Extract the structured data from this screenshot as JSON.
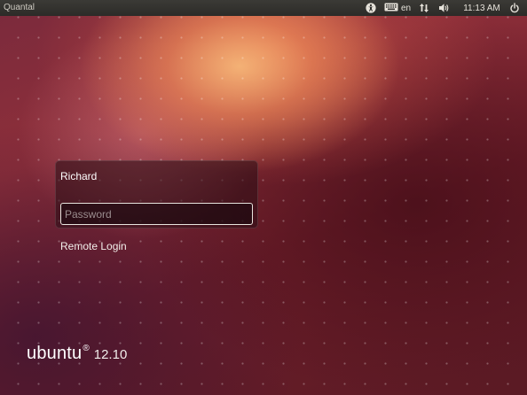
{
  "top_panel": {
    "hostname": "Quantal",
    "keyboard_layout": "en",
    "clock": "11:13 AM",
    "icons": {
      "accessibility": "accessibility-icon",
      "keyboard": "keyboard-icon",
      "network": "network-icon",
      "sound": "sound-icon",
      "power": "power-icon"
    }
  },
  "login": {
    "user_name": "Richard",
    "password_placeholder": "Password",
    "password_value": ""
  },
  "remote_login_label": "Remote Login",
  "branding": {
    "word": "ubuntu",
    "registered": "®",
    "version": "12.10"
  },
  "colors": {
    "panel_bg": "#2c2b28",
    "wallpaper_dark": "#5a1a24",
    "wallpaper_highlight": "#f6b678",
    "text": "#ffffff"
  }
}
